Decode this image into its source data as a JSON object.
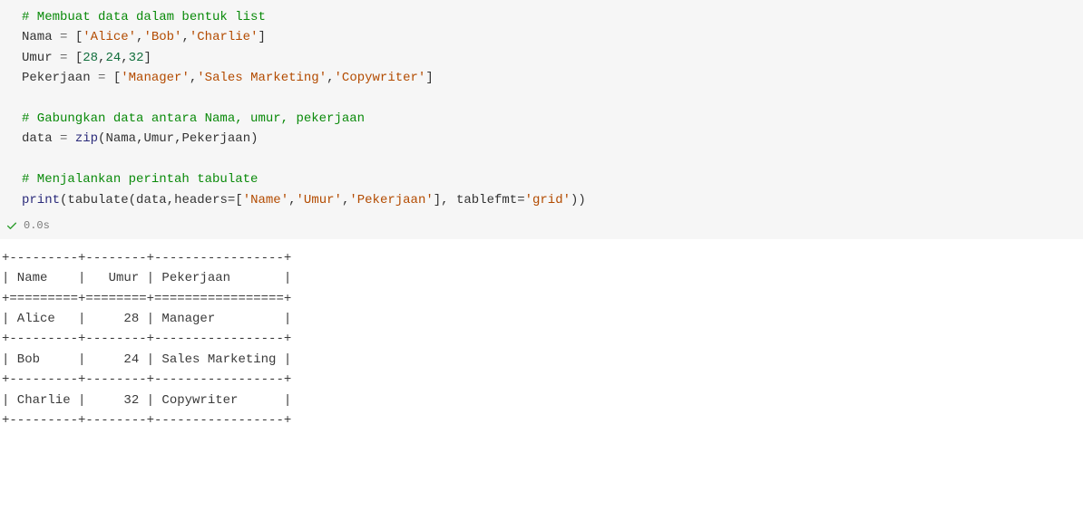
{
  "code": {
    "comment1": "# Membuat data dalam bentuk list",
    "nama_var": "Nama",
    "eq": "=",
    "nama_open": "[",
    "nama_s1": "'Alice'",
    "comma": ",",
    "nama_s2": "'Bob'",
    "nama_s3": "'Charlie'",
    "nama_close": "]",
    "umur_var": "Umur",
    "umur_open": "[",
    "umur_n1": "28",
    "umur_n2": "24",
    "umur_n3": "32",
    "umur_close": "]",
    "pek_var": "Pekerjaan",
    "pek_open": "[",
    "pek_s1": "'Manager'",
    "pek_s2": "'Sales Marketing'",
    "pek_s3": "'Copywriter'",
    "pek_close": "]",
    "comment2": "# Gabungkan data antara Nama, umur, pekerjaan",
    "data_var": "data",
    "zip_fn": "zip",
    "zip_args_open": "(",
    "zip_a1": "Nama",
    "zip_a2": "Umur",
    "zip_a3": "Pekerjaan",
    "zip_args_close": ")",
    "comment3": "# Menjalankan perintah tabulate",
    "print_fn": "print",
    "print_open": "(",
    "tabulate_fn": "tabulate",
    "tab_open": "(",
    "tab_a1": "data",
    "tab_kw_headers": "headers=",
    "tab_h_open": "[",
    "tab_h_s1": "'Name'",
    "tab_h_s2": "'Umur'",
    "tab_h_s3": "'Pekerjaan'",
    "tab_h_close": "]",
    "tab_kw_fmt": " tablefmt=",
    "tab_fmt_s": "'grid'",
    "tab_close": ")",
    "print_close": ")"
  },
  "status": {
    "time": "0.0s"
  },
  "output": {
    "line1": "+---------+--------+-----------------+",
    "line2": "| Name    |   Umur | Pekerjaan       |",
    "line3": "+=========+========+=================+",
    "line4": "| Alice   |     28 | Manager         |",
    "line5": "+---------+--------+-----------------+",
    "line6": "| Bob     |     24 | Sales Marketing |",
    "line7": "+---------+--------+-----------------+",
    "line8": "| Charlie |     32 | Copywriter      |",
    "line9": "+---------+--------+-----------------+"
  },
  "chart_data": {
    "type": "table",
    "headers": [
      "Name",
      "Umur",
      "Pekerjaan"
    ],
    "rows": [
      [
        "Alice",
        28,
        "Manager"
      ],
      [
        "Bob",
        24,
        "Sales Marketing"
      ],
      [
        "Charlie",
        32,
        "Copywriter"
      ]
    ]
  }
}
